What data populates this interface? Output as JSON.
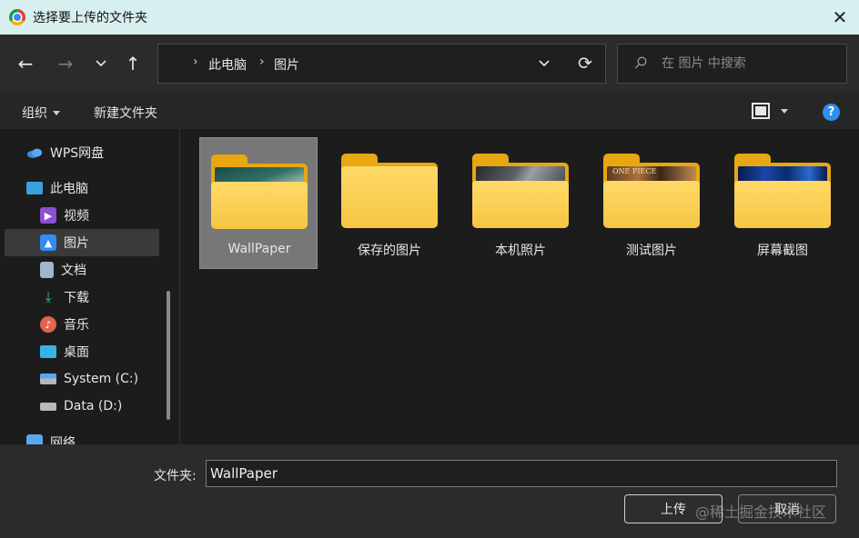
{
  "window": {
    "title": "选择要上传的文件夹",
    "close_symbol": "✕"
  },
  "nav": {
    "back_symbol": "←",
    "forward_symbol": "→",
    "up_symbol": "↑",
    "refresh_symbol": "⟳",
    "breadcrumb": [
      "此电脑",
      "图片"
    ],
    "breadcrumb_separator": "›"
  },
  "search": {
    "placeholder": "在 图片 中搜索"
  },
  "commandbar": {
    "organize": "组织",
    "new_folder": "新建文件夹",
    "help": "?"
  },
  "sidebar": {
    "items": [
      {
        "label": "WPS网盘",
        "icon": "cloud-icon"
      },
      {
        "label": "此电脑",
        "icon": "computer-icon"
      },
      {
        "label": "视频",
        "icon": "video-icon"
      },
      {
        "label": "图片",
        "icon": "pictures-icon",
        "selected": true
      },
      {
        "label": "文档",
        "icon": "document-icon"
      },
      {
        "label": "下载",
        "icon": "download-icon"
      },
      {
        "label": "音乐",
        "icon": "music-icon"
      },
      {
        "label": "桌面",
        "icon": "desktop-icon"
      },
      {
        "label": "System (C:)",
        "icon": "drive-c-icon"
      },
      {
        "label": "Data (D:)",
        "icon": "drive-d-icon"
      },
      {
        "label": "网络",
        "icon": "network-icon"
      }
    ]
  },
  "folders": [
    {
      "name": "WallPaper",
      "selected": true,
      "thumbnail": "night-sky-icon"
    },
    {
      "name": "保存的图片",
      "thumbnail": "none"
    },
    {
      "name": "本机照片",
      "thumbnail": "screenshot-icon"
    },
    {
      "name": "测试图片",
      "thumbnail": "anime-poster-icon",
      "thumb_text": "ONE PIECE"
    },
    {
      "name": "屏幕截图",
      "thumbnail": "blue-scene-icon"
    }
  ],
  "bottom": {
    "folder_label": "文件夹:",
    "folder_value": "WallPaper",
    "upload_button": "上传",
    "cancel_button": "取消",
    "watermark": "@稀土掘金技术社区"
  },
  "colors": {
    "accent": "#2f8ef0",
    "folder": "#f6c642",
    "titlebar": "#d8efef"
  }
}
